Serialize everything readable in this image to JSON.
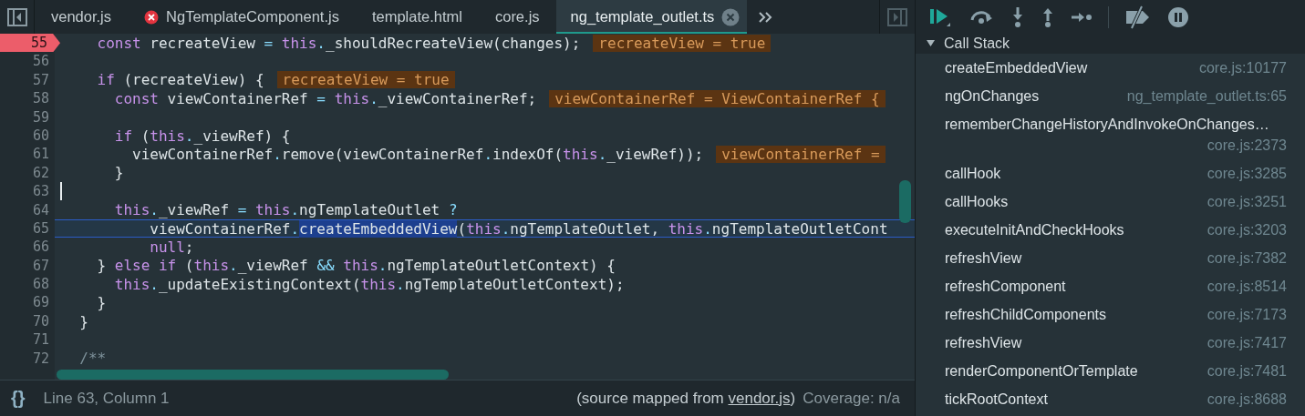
{
  "tabs": [
    {
      "label": "vendor.js",
      "selected": false,
      "error": false,
      "closable": false
    },
    {
      "label": "NgTemplateComponent.js",
      "selected": false,
      "error": true,
      "closable": false
    },
    {
      "label": "template.html",
      "selected": false,
      "error": false,
      "closable": false
    },
    {
      "label": "core.js",
      "selected": false,
      "error": false,
      "closable": false
    },
    {
      "label": "ng_template_outlet.ts",
      "selected": true,
      "error": false,
      "closable": true
    }
  ],
  "editor": {
    "lines": [
      {
        "number": "55",
        "breakpoint": true,
        "paused": false,
        "cursor": false,
        "tokens": [
          {
            "kind": "keyword",
            "text": "    const"
          },
          {
            "kind": "plain",
            "text": " recreateView "
          },
          {
            "kind": "operator",
            "text": "= "
          },
          {
            "kind": "keyword",
            "text": "this"
          },
          {
            "kind": "operator",
            "text": "."
          },
          {
            "kind": "plain",
            "text": "_shouldRecreateView(changes);"
          }
        ],
        "hint": "recreateView = true"
      },
      {
        "number": "56",
        "breakpoint": false,
        "paused": false,
        "cursor": false
      },
      {
        "number": "57",
        "breakpoint": false,
        "paused": false,
        "cursor": false,
        "tokens": [
          {
            "kind": "keyword",
            "text": "    if"
          },
          {
            "kind": "plain",
            "text": " (recreateView) {"
          }
        ],
        "hint": "recreateView = true"
      },
      {
        "number": "58",
        "breakpoint": false,
        "paused": false,
        "cursor": false,
        "tokens": [
          {
            "kind": "keyword",
            "text": "      const"
          },
          {
            "kind": "plain",
            "text": " viewContainerRef "
          },
          {
            "kind": "operator",
            "text": "= "
          },
          {
            "kind": "keyword",
            "text": "this"
          },
          {
            "kind": "operator",
            "text": "."
          },
          {
            "kind": "plain",
            "text": "_viewContainerRef;"
          }
        ],
        "hint": "viewContainerRef = ViewContainerRef {"
      },
      {
        "number": "59",
        "breakpoint": false,
        "paused": false,
        "cursor": false
      },
      {
        "number": "60",
        "breakpoint": false,
        "paused": false,
        "cursor": false,
        "tokens": [
          {
            "kind": "keyword",
            "text": "      if"
          },
          {
            "kind": "plain",
            "text": " ("
          },
          {
            "kind": "keyword",
            "text": "this"
          },
          {
            "kind": "operator",
            "text": "."
          },
          {
            "kind": "plain",
            "text": "_viewRef) {"
          }
        ]
      },
      {
        "number": "61",
        "breakpoint": false,
        "paused": false,
        "cursor": false,
        "tokens": [
          {
            "kind": "plain",
            "text": "        viewContainerRef"
          },
          {
            "kind": "operator",
            "text": "."
          },
          {
            "kind": "plain",
            "text": "remove(viewContainerRef"
          },
          {
            "kind": "operator",
            "text": "."
          },
          {
            "kind": "plain",
            "text": "indexOf("
          },
          {
            "kind": "keyword",
            "text": "this"
          },
          {
            "kind": "operator",
            "text": "."
          },
          {
            "kind": "plain",
            "text": "_viewRef));"
          }
        ],
        "hint": "viewContainerRef ="
      },
      {
        "number": "62",
        "breakpoint": false,
        "paused": false,
        "cursor": false,
        "tokens": [
          {
            "kind": "plain",
            "text": "      }"
          }
        ]
      },
      {
        "number": "63",
        "breakpoint": false,
        "paused": false,
        "cursor": true
      },
      {
        "number": "64",
        "breakpoint": false,
        "paused": false,
        "cursor": false,
        "tokens": [
          {
            "kind": "keyword",
            "text": "      this"
          },
          {
            "kind": "operator",
            "text": "."
          },
          {
            "kind": "plain",
            "text": "_viewRef "
          },
          {
            "kind": "operator",
            "text": "= "
          },
          {
            "kind": "keyword",
            "text": "this"
          },
          {
            "kind": "operator",
            "text": "."
          },
          {
            "kind": "plain",
            "text": "ngTemplateOutlet "
          },
          {
            "kind": "operator",
            "text": "?"
          }
        ]
      },
      {
        "number": "65",
        "breakpoint": false,
        "paused": true,
        "cursor": false,
        "tokens": [
          {
            "kind": "plain",
            "text": "          viewContainerRef"
          },
          {
            "kind": "operator",
            "text": "."
          },
          {
            "kind": "selected",
            "text": "createEmbeddedView"
          },
          {
            "kind": "plain",
            "text": "("
          },
          {
            "kind": "keyword",
            "text": "this"
          },
          {
            "kind": "operator",
            "text": "."
          },
          {
            "kind": "plain",
            "text": "ngTemplateOutlet, "
          },
          {
            "kind": "keyword",
            "text": "this"
          },
          {
            "kind": "operator",
            "text": "."
          },
          {
            "kind": "plain",
            "text": "ngTemplateOutletCont"
          }
        ]
      },
      {
        "number": "66",
        "breakpoint": false,
        "paused": false,
        "cursor": false,
        "tokens": [
          {
            "kind": "keyword",
            "text": "          null"
          },
          {
            "kind": "plain",
            "text": ";"
          }
        ]
      },
      {
        "number": "67",
        "breakpoint": false,
        "paused": false,
        "cursor": false,
        "tokens": [
          {
            "kind": "plain",
            "text": "    } "
          },
          {
            "kind": "keyword",
            "text": "else if"
          },
          {
            "kind": "plain",
            "text": " ("
          },
          {
            "kind": "keyword",
            "text": "this"
          },
          {
            "kind": "operator",
            "text": "."
          },
          {
            "kind": "plain",
            "text": "_viewRef "
          },
          {
            "kind": "operator",
            "text": "&& "
          },
          {
            "kind": "keyword",
            "text": "this"
          },
          {
            "kind": "operator",
            "text": "."
          },
          {
            "kind": "plain",
            "text": "ngTemplateOutletContext) {"
          }
        ]
      },
      {
        "number": "68",
        "breakpoint": false,
        "paused": false,
        "cursor": false,
        "tokens": [
          {
            "kind": "keyword",
            "text": "      this"
          },
          {
            "kind": "operator",
            "text": "."
          },
          {
            "kind": "plain",
            "text": "_updateExistingContext("
          },
          {
            "kind": "keyword",
            "text": "this"
          },
          {
            "kind": "operator",
            "text": "."
          },
          {
            "kind": "plain",
            "text": "ngTemplateOutletContext);"
          }
        ]
      },
      {
        "number": "69",
        "breakpoint": false,
        "paused": false,
        "cursor": false,
        "tokens": [
          {
            "kind": "plain",
            "text": "    }"
          }
        ]
      },
      {
        "number": "70",
        "breakpoint": false,
        "paused": false,
        "cursor": false,
        "tokens": [
          {
            "kind": "plain",
            "text": "  }"
          }
        ]
      },
      {
        "number": "71",
        "breakpoint": false,
        "paused": false,
        "cursor": false
      },
      {
        "number": "72",
        "breakpoint": false,
        "paused": false,
        "cursor": false,
        "tokens": [
          {
            "kind": "comment",
            "text": "  /**"
          }
        ]
      }
    ]
  },
  "status_bar": {
    "format_button": "{}",
    "position": "Line 63, Column 1",
    "source_prefix": "(source mapped from ",
    "source_link": "vendor.js",
    "source_suffix": ")",
    "coverage": "Coverage: n/a"
  },
  "debugger": {
    "call_stack": {
      "title": "Call Stack",
      "expanded": true,
      "frames": [
        {
          "function": "createEmbeddedView",
          "location": "core.js:10177"
        },
        {
          "function": "ngOnChanges",
          "location": "ng_template_outlet.ts:65"
        },
        {
          "function": "rememberChangeHistoryAndInvokeOnChanges…",
          "location": "core.js:2373"
        },
        {
          "function": "callHook",
          "location": "core.js:3285"
        },
        {
          "function": "callHooks",
          "location": "core.js:3251"
        },
        {
          "function": "executeInitAndCheckHooks",
          "location": "core.js:3203"
        },
        {
          "function": "refreshView",
          "location": "core.js:7382"
        },
        {
          "function": "refreshComponent",
          "location": "core.js:8514"
        },
        {
          "function": "refreshChildComponents",
          "location": "core.js:7173"
        },
        {
          "function": "refreshView",
          "location": "core.js:7417"
        },
        {
          "function": "renderComponentOrTemplate",
          "location": "core.js:7481"
        },
        {
          "function": "tickRootContext",
          "location": "core.js:8688"
        }
      ]
    }
  }
}
